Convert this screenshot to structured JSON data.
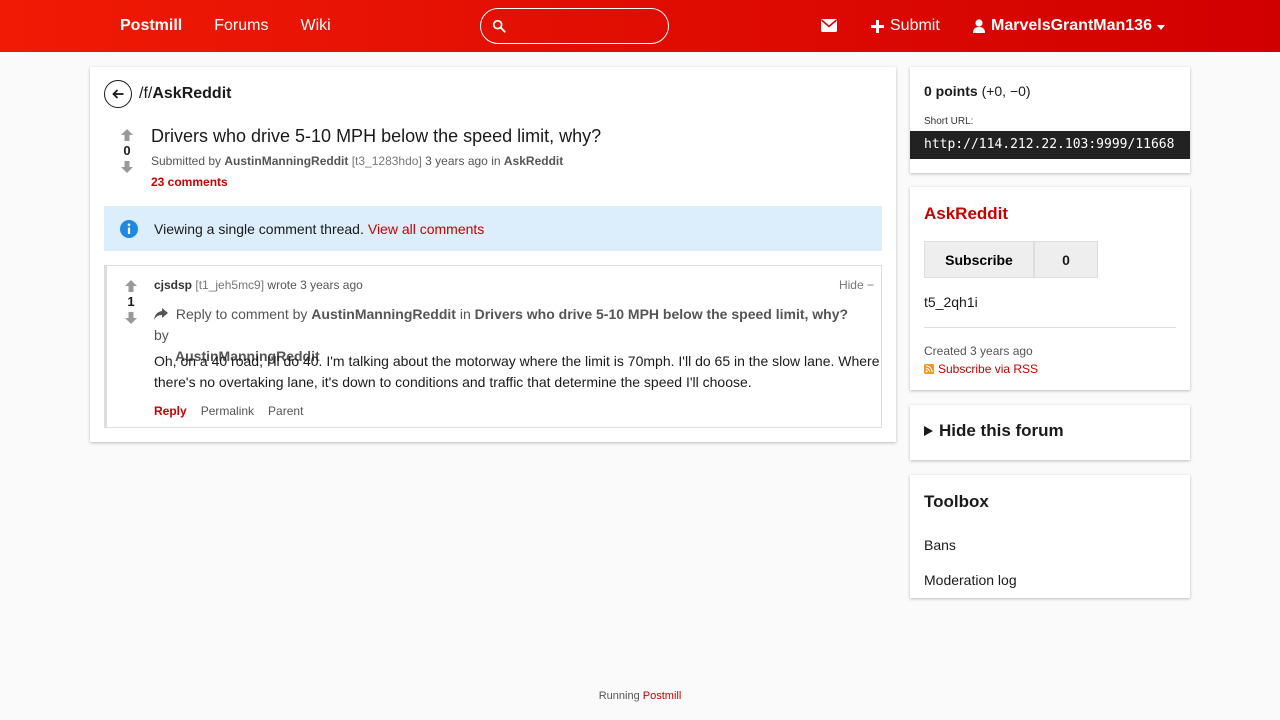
{
  "nav": {
    "brand": "Postmill",
    "forums": "Forums",
    "wiki": "Wiki",
    "search_placeholder": "",
    "submit": "Submit",
    "username": "MarvelsGrantMan136"
  },
  "post": {
    "forum_prefix": "/f/",
    "forum": "AskReddit",
    "score": "0",
    "title": "Drivers who drive 5-10 MPH below the speed limit, why?",
    "submitted_by": "Submitted by",
    "author": "AustinManningReddit",
    "id": "[t3_1283hdo]",
    "time": "3 years ago",
    "in": "in",
    "forum_link": "AskReddit",
    "comments": "23 comments"
  },
  "alert": {
    "text": "Viewing a single comment thread.",
    "link": "View all comments"
  },
  "comment": {
    "score": "1",
    "author": "cjsdsp",
    "id": "[t1_jeh5mc9]",
    "wrote": "wrote 3 years ago",
    "hide": "Hide −",
    "reply_prefix": "Reply to comment by",
    "reply_author": "AustinManningReddit",
    "reply_in": "in",
    "reply_post": "Drivers who drive 5-10 MPH below the speed limit, why?",
    "reply_by": "by",
    "reply_post_author": "AustinManningReddit",
    "body": "Oh, on a 40 road, I'll do 40. I'm talking about the motorway where the limit is 70mph. I'll do 65 in the slow lane. Where there's no overtaking lane, it's down to conditions and traffic that determine the speed I'll choose.",
    "actions": {
      "reply": "Reply",
      "permalink": "Permalink",
      "parent": "Parent"
    }
  },
  "sidebar": {
    "points_bold": "0 points",
    "points_detail": "(+0, −0)",
    "short_url_label": "Short URL:",
    "short_url": "http://114.212.22.103:9999/11668",
    "forum_name": "AskReddit",
    "subscribe": "Subscribe",
    "subscribers": "0",
    "forum_id": "t5_2qh1i",
    "created": "Created 3 years ago",
    "rss": "Subscribe via RSS",
    "hide_forum": "Hide this forum",
    "toolbox": "Toolbox",
    "bans": "Bans",
    "modlog": "Moderation log"
  },
  "footer": {
    "prefix": "Running",
    "link": "Postmill"
  },
  "colors": {
    "brand_red": "#d10000",
    "link_red": "#c80000",
    "alert_bg": "#dceefc",
    "info_blue": "#1e88e5"
  }
}
